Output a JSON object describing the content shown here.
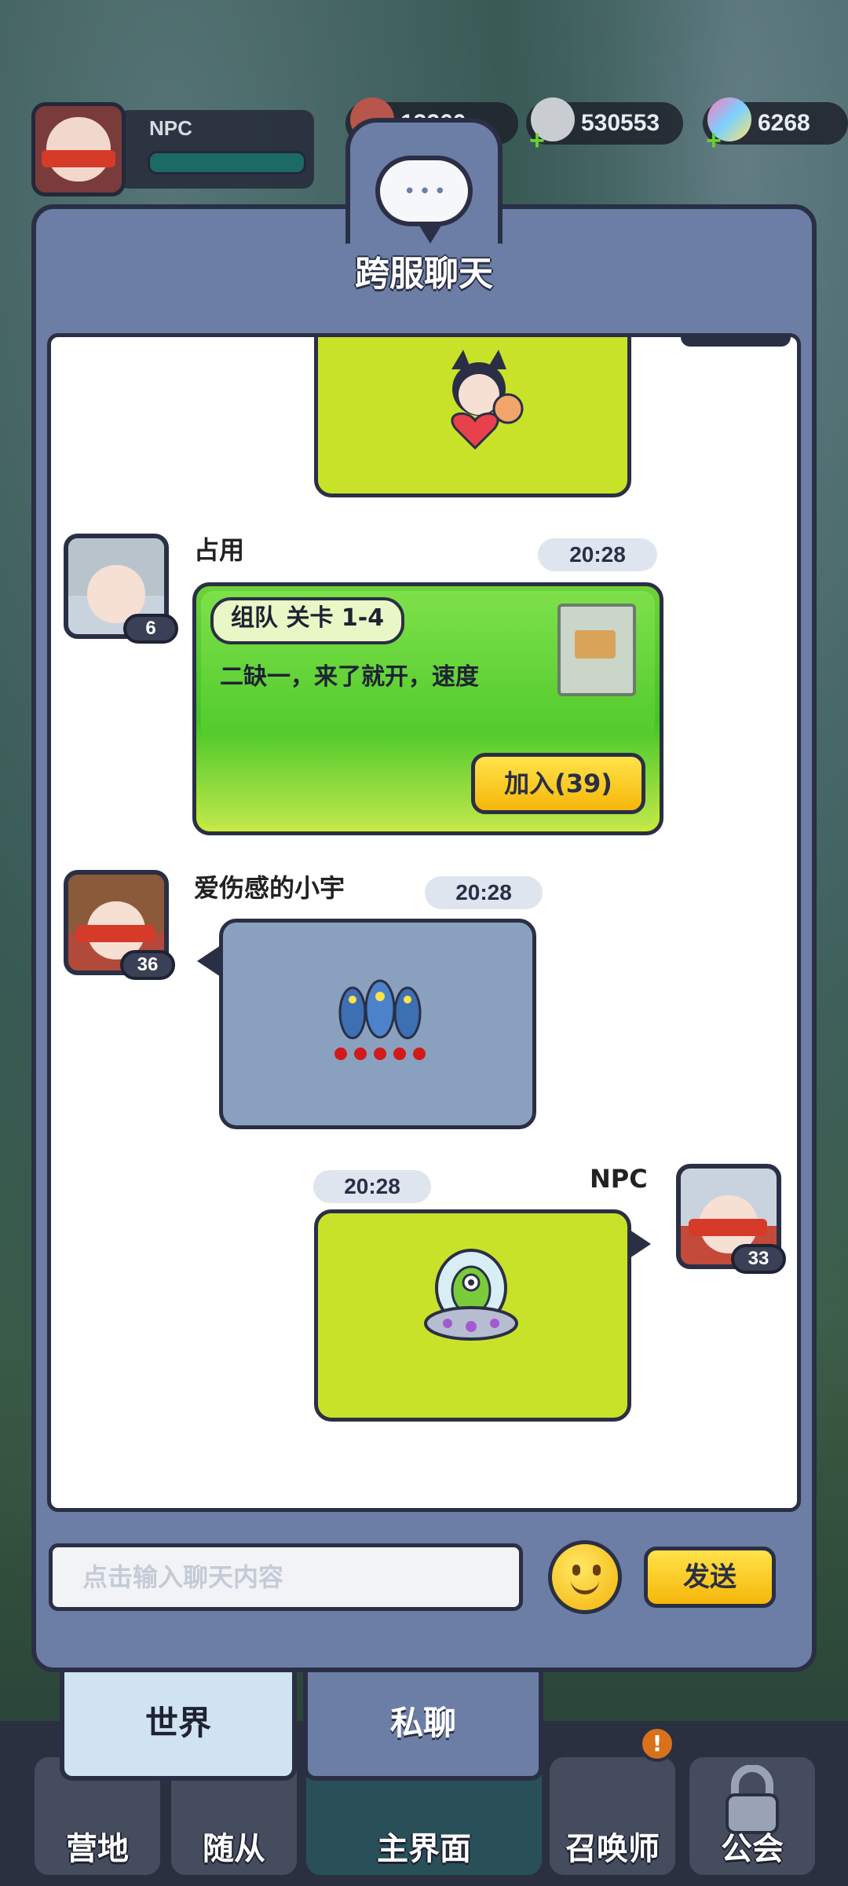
{
  "hud": {
    "player_name": "NPC",
    "resources": [
      {
        "icon": "meat-icon",
        "value": "13260"
      },
      {
        "icon": "ore-icon",
        "value": "530553"
      },
      {
        "icon": "gem-icon",
        "value": "6268"
      }
    ]
  },
  "panel": {
    "title": "跨服聊天"
  },
  "messages": [
    {
      "kind": "sticker",
      "side": "self",
      "sticker": "fox-girl-heart-sticker"
    },
    {
      "kind": "team",
      "side": "other",
      "user": "占用",
      "level": "6",
      "time": "20:28",
      "tag": "组队 关卡 1-4",
      "text": "二缺一，来了就开，速度",
      "join_label": "加入(39)"
    },
    {
      "kind": "sticker",
      "side": "other",
      "user": "爱伤感的小宇",
      "level": "36",
      "time": "20:28",
      "sticker": "fish-squad-sticker",
      "stars": 5
    },
    {
      "kind": "sticker",
      "side": "self",
      "user": "NPC",
      "level": "33",
      "time": "20:28",
      "sticker": "alien-ufo-sticker"
    }
  ],
  "input": {
    "placeholder": "点击输入聊天内容",
    "send_label": "发送"
  },
  "tabs": [
    {
      "label": "世界",
      "active": true
    },
    {
      "label": "私聊",
      "active": false
    }
  ],
  "nav": [
    {
      "label": "营地"
    },
    {
      "label": "随从"
    },
    {
      "label": "主界面"
    },
    {
      "label": "召唤师",
      "badge": "!"
    },
    {
      "label": "公会"
    }
  ],
  "colors": {
    "panel": "#6c7ea6",
    "outline": "#2a2f45",
    "bubble_green": "#c8e22a",
    "bubble_blue": "#8aa0bf",
    "button_yellow": "#f5b60a"
  }
}
